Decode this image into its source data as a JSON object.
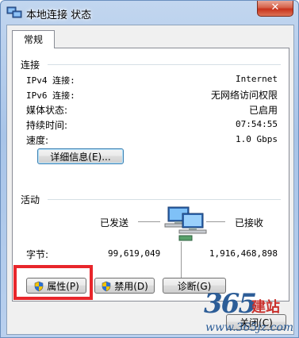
{
  "window": {
    "title": "本地连接 状态",
    "close_glyph": "✕"
  },
  "tabs": [
    {
      "label": "常规"
    }
  ],
  "connection": {
    "heading": "连接",
    "rows": [
      {
        "label": "IPv4 连接:",
        "value": "Internet"
      },
      {
        "label": "IPv6 连接:",
        "value": "无网络访问权限"
      },
      {
        "label": "媒体状态:",
        "value": "已启用"
      },
      {
        "label": "持续时间:",
        "value": "07:54:55"
      },
      {
        "label": "速度:",
        "value": "1.0 Gbps"
      }
    ],
    "details_button": "详细信息(E)..."
  },
  "activity": {
    "heading": "活动",
    "sent_label": "已发送",
    "received_label": "已接收",
    "bytes_label": "字节:",
    "bytes_sent": "99,619,049",
    "bytes_received": "1,916,468,898",
    "network_icon": "network-computers-icon"
  },
  "buttons": {
    "properties": "属性(P)",
    "disable": "禁用(D)",
    "diagnose": "诊断(G)",
    "close": "关闭(C)"
  },
  "watermark": {
    "number": "365",
    "text": "建站",
    "url": "www.365jz.com"
  },
  "colors": {
    "highlight": "#e8262b",
    "title_bar": "#b9d0ee"
  }
}
